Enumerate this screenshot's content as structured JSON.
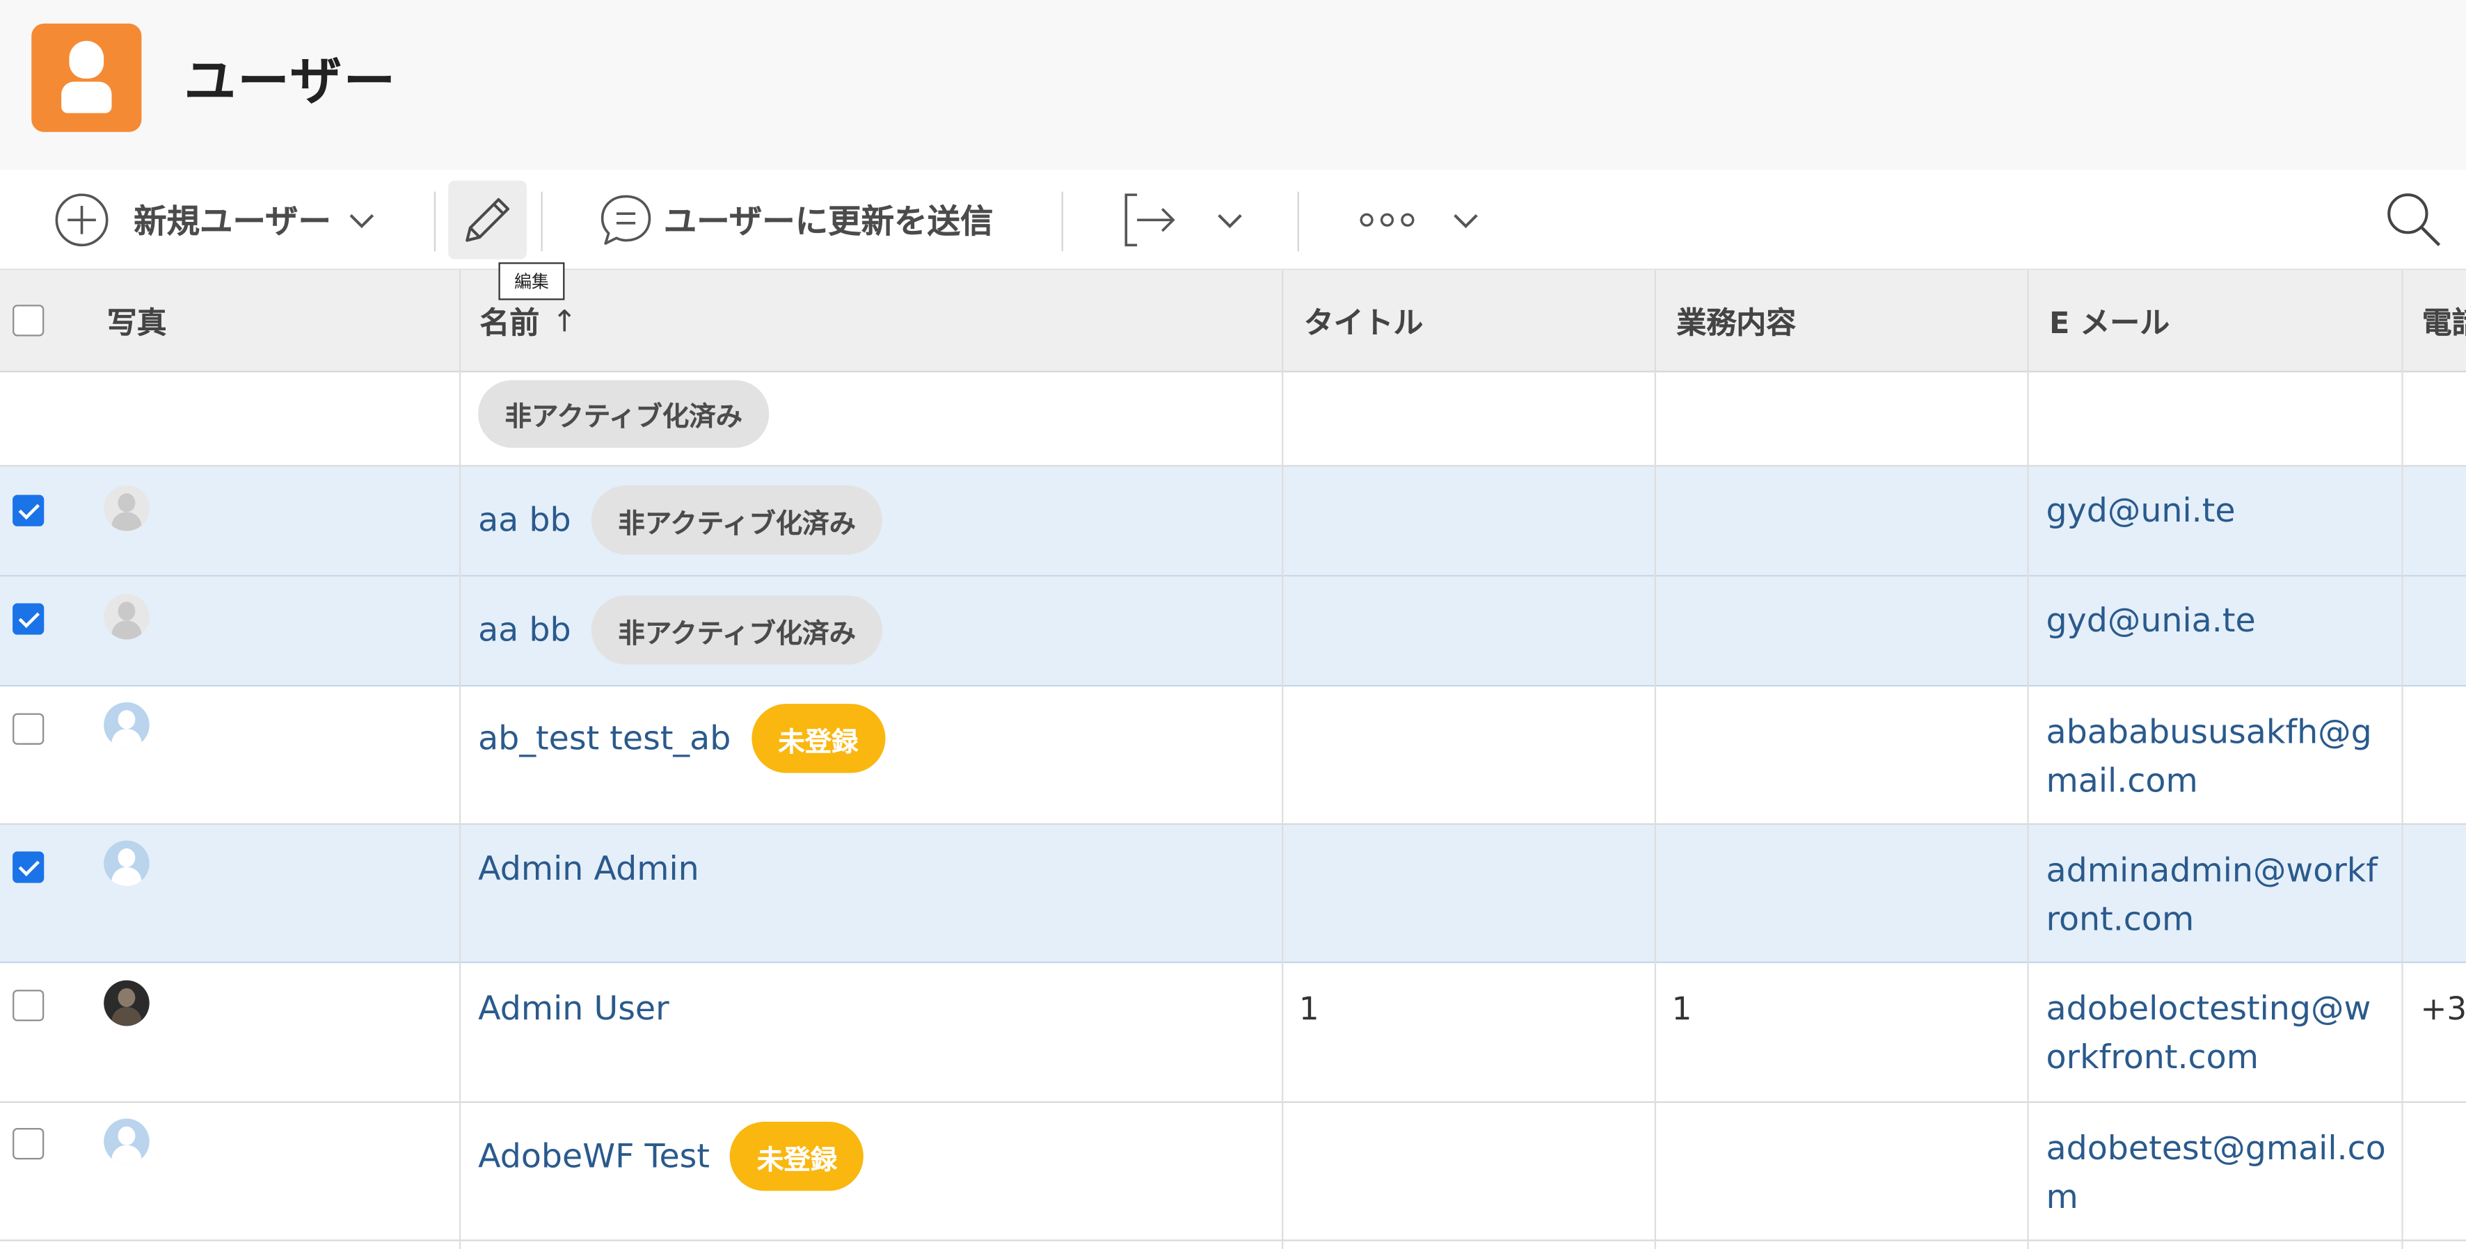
{
  "header": {
    "title": "ユーザー",
    "icon": "user-icon",
    "accent": "#f58a34"
  },
  "toolbar": {
    "new_user_label": "新規ユーザー",
    "edit_tooltip": "編集",
    "send_update_label": "ユーザーに更新を送信",
    "export_icon": "export-icon",
    "more_icon": "more-icon",
    "search_icon": "search-icon"
  },
  "table": {
    "columns": {
      "photo": "写真",
      "name": "名前",
      "sort_indicator": "↑",
      "title": "タイトル",
      "job": "業務内容",
      "email": "E メール",
      "phone": "電話"
    },
    "partial_row": {
      "badge": "非アクティブ化済み"
    },
    "rows": [
      {
        "selected": true,
        "avatar": "gray",
        "name": "aa bb",
        "badge": "非アクティブ化済み",
        "badge_type": "inactive",
        "title": "",
        "job": "",
        "email": "gyd@uni.te",
        "phone": ""
      },
      {
        "selected": true,
        "avatar": "gray",
        "name": "aa bb",
        "badge": "非アクティブ化済み",
        "badge_type": "inactive",
        "title": "",
        "job": "",
        "email": "gyd@unia.te",
        "phone": ""
      },
      {
        "selected": false,
        "avatar": "blue",
        "name": "ab_test test_ab",
        "badge": "未登録",
        "badge_type": "unregistered",
        "title": "",
        "job": "",
        "email": "abababususakfh@gmail.com",
        "phone": ""
      },
      {
        "selected": true,
        "avatar": "blue",
        "name": "Admin Admin",
        "badge": "",
        "badge_type": "",
        "title": "",
        "job": "",
        "email": "adminadmin@workfront.com",
        "phone": ""
      },
      {
        "selected": false,
        "avatar": "photo",
        "name": "Admin User",
        "badge": "",
        "badge_type": "",
        "title": "1",
        "job": "1",
        "email": "adobeloctesting@workfront.com",
        "phone": "+3"
      },
      {
        "selected": false,
        "avatar": "blue",
        "name": "AdobeWF Test",
        "badge": "未登録",
        "badge_type": "unregistered",
        "title": "",
        "job": "",
        "email": "adobetest@gmail.com",
        "phone": ""
      }
    ]
  }
}
